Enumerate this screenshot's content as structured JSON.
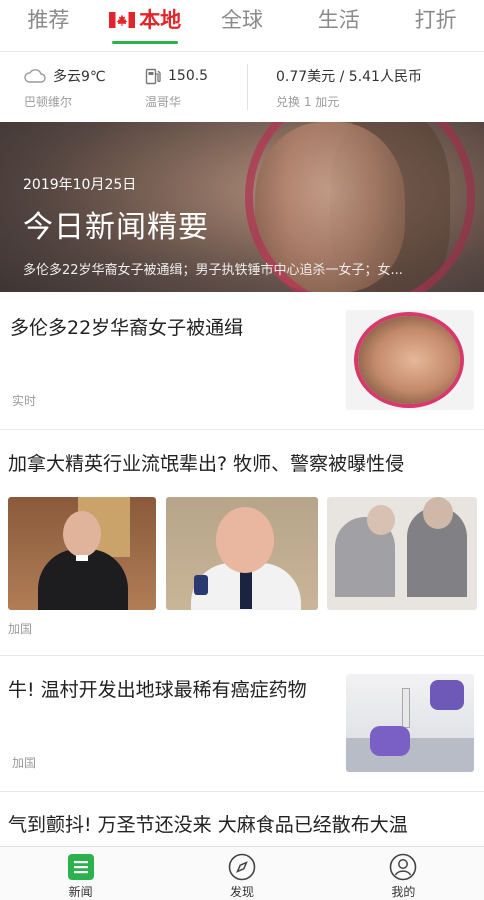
{
  "tabs": [
    {
      "label": "推荐"
    },
    {
      "label": "本地"
    },
    {
      "label": "全球"
    },
    {
      "label": "生活"
    },
    {
      "label": "打折"
    }
  ],
  "active_tab_color": "#e0262b",
  "accent_color": "#2bb24c",
  "info_bar": {
    "weather": {
      "value": "多云9℃",
      "location": "巴顿维尔",
      "icon": "cloud-icon"
    },
    "fuel": {
      "value": "150.5",
      "location": "温哥华",
      "icon": "gas-pump-icon"
    },
    "exchange": {
      "value": "0.77美元 / 5.41人民币",
      "label": "兑换 1 加元"
    }
  },
  "banner": {
    "date": "2019年10月25日",
    "title": "今日新闻精要",
    "summary": "多伦多22岁华裔女子被通缉；男子执铁锤市中心追杀一女子；女..."
  },
  "news": [
    {
      "headline": "多伦多22岁华裔女子被通缉",
      "tag": "实时"
    },
    {
      "headline": "加拿大精英行业流氓辈出? 牧师、警察被曝性侵",
      "tag": "加国"
    },
    {
      "headline": "牛! 温村开发出地球最稀有癌症药物",
      "tag": "加国"
    },
    {
      "headline": "气到颤抖! 万圣节还没来 大麻食品已经散布大温"
    }
  ],
  "bottom_nav": [
    {
      "label": "新闻",
      "icon": "news-list-icon",
      "active": true
    },
    {
      "label": "发现",
      "icon": "compass-icon"
    },
    {
      "label": "我的",
      "icon": "user-icon"
    }
  ]
}
